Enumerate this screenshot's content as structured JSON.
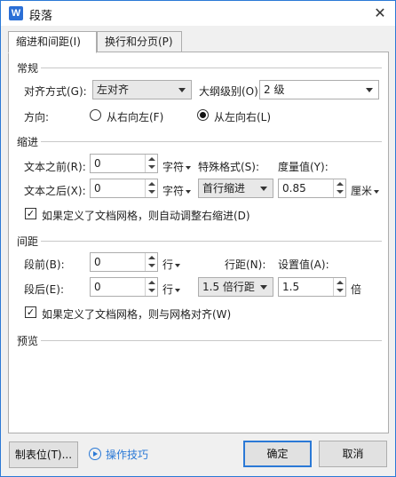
{
  "window": {
    "app_icon_letter": "W",
    "title": "段落",
    "close_glyph": "✕"
  },
  "tabs": [
    {
      "label": "缩进和间距(I)",
      "active": true
    },
    {
      "label": "换行和分页(P)",
      "active": false
    }
  ],
  "general": {
    "section_label": "常规",
    "alignment_label": "对齐方式(G):",
    "alignment_value": "左对齐",
    "outline_label": "大纲级别(O):",
    "outline_value": "2 级",
    "direction_label": "方向:",
    "rtl_label": "从右向左(F)",
    "ltr_label": "从左向右(L)",
    "rtl_selected": false,
    "ltr_selected": true
  },
  "indent": {
    "section_label": "缩进",
    "before_label": "文本之前(R):",
    "before_value": "0",
    "before_unit": "字符",
    "after_label": "文本之后(X):",
    "after_value": "0",
    "after_unit": "字符",
    "special_label": "特殊格式(S):",
    "special_value": "首行缩进",
    "measure_label": "度量值(Y):",
    "measure_value": "0.85",
    "measure_unit": "厘米",
    "grid_check_label": "如果定义了文档网格，则自动调整右缩进(D)",
    "grid_checked": true
  },
  "spacing": {
    "section_label": "间距",
    "before_label": "段前(B):",
    "before_value": "0",
    "before_unit": "行",
    "after_label": "段后(E):",
    "after_value": "0",
    "after_unit": "行",
    "line_label": "行距(N):",
    "line_value": "1.5 倍行距",
    "setting_label": "设置值(A):",
    "setting_value": "1.5",
    "setting_unit": "倍",
    "grid_check_label": "如果定义了文档网格，则与网格对齐(W)",
    "grid_checked": true
  },
  "preview": {
    "section_label": "预览"
  },
  "footer": {
    "tabs_button": "制表位(T)...",
    "tips_link": "操作技巧",
    "ok_button": "确定",
    "cancel_button": "取消"
  },
  "colors": {
    "accent": "#2b79d6",
    "panel_bg": "#ffffff",
    "dialog_bg": "#f0f0f0"
  }
}
